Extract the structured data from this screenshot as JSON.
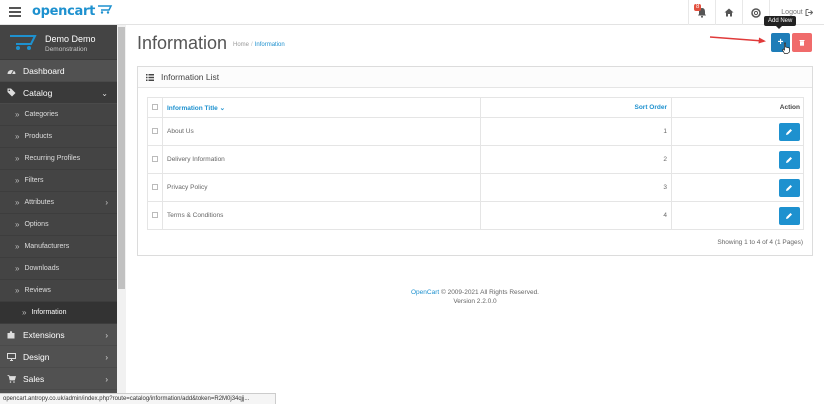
{
  "header": {
    "logo_text": "opencart",
    "notification_count": "8",
    "logout_label": "Logout"
  },
  "profile": {
    "name": "Demo Demo",
    "role": "Demonstration"
  },
  "sidebar": {
    "items": [
      {
        "label": "Dashboard",
        "icon": "dashboard-icon"
      },
      {
        "label": "Catalog",
        "icon": "tags-icon"
      }
    ],
    "catalog_sub": [
      {
        "label": "Categories"
      },
      {
        "label": "Products"
      },
      {
        "label": "Recurring Profiles"
      },
      {
        "label": "Filters"
      },
      {
        "label": "Attributes"
      },
      {
        "label": "Options"
      },
      {
        "label": "Manufacturers"
      },
      {
        "label": "Downloads"
      },
      {
        "label": "Reviews"
      },
      {
        "label": "Information"
      }
    ],
    "bottom": [
      {
        "label": "Extensions",
        "icon": "puzzle-icon"
      },
      {
        "label": "Design",
        "icon": "desktop-icon"
      },
      {
        "label": "Sales",
        "icon": "cart-icon"
      }
    ]
  },
  "page": {
    "title": "Information",
    "breadcrumb": [
      "Home",
      "Information"
    ],
    "add_tooltip": "Add New"
  },
  "panel": {
    "title": "Information List",
    "columns": {
      "title": "Information Title",
      "sort": "Sort Order",
      "action": "Action"
    },
    "rows": [
      {
        "title": "About Us",
        "sort": "1"
      },
      {
        "title": "Delivery Information",
        "sort": "2"
      },
      {
        "title": "Privacy Policy",
        "sort": "3"
      },
      {
        "title": "Terms & Conditions",
        "sort": "4"
      }
    ],
    "showing": "Showing 1 to 4 of 4 (1 Pages)"
  },
  "footer": {
    "link": "OpenCart",
    "copyright": " © 2009-2021 All Rights Reserved.",
    "version": "Version 2.2.0.0"
  },
  "statusbar": "opencart.antropy.co.uk/admin/index.php?route=catalog/information/add&token=R2M0j34qjj..."
}
